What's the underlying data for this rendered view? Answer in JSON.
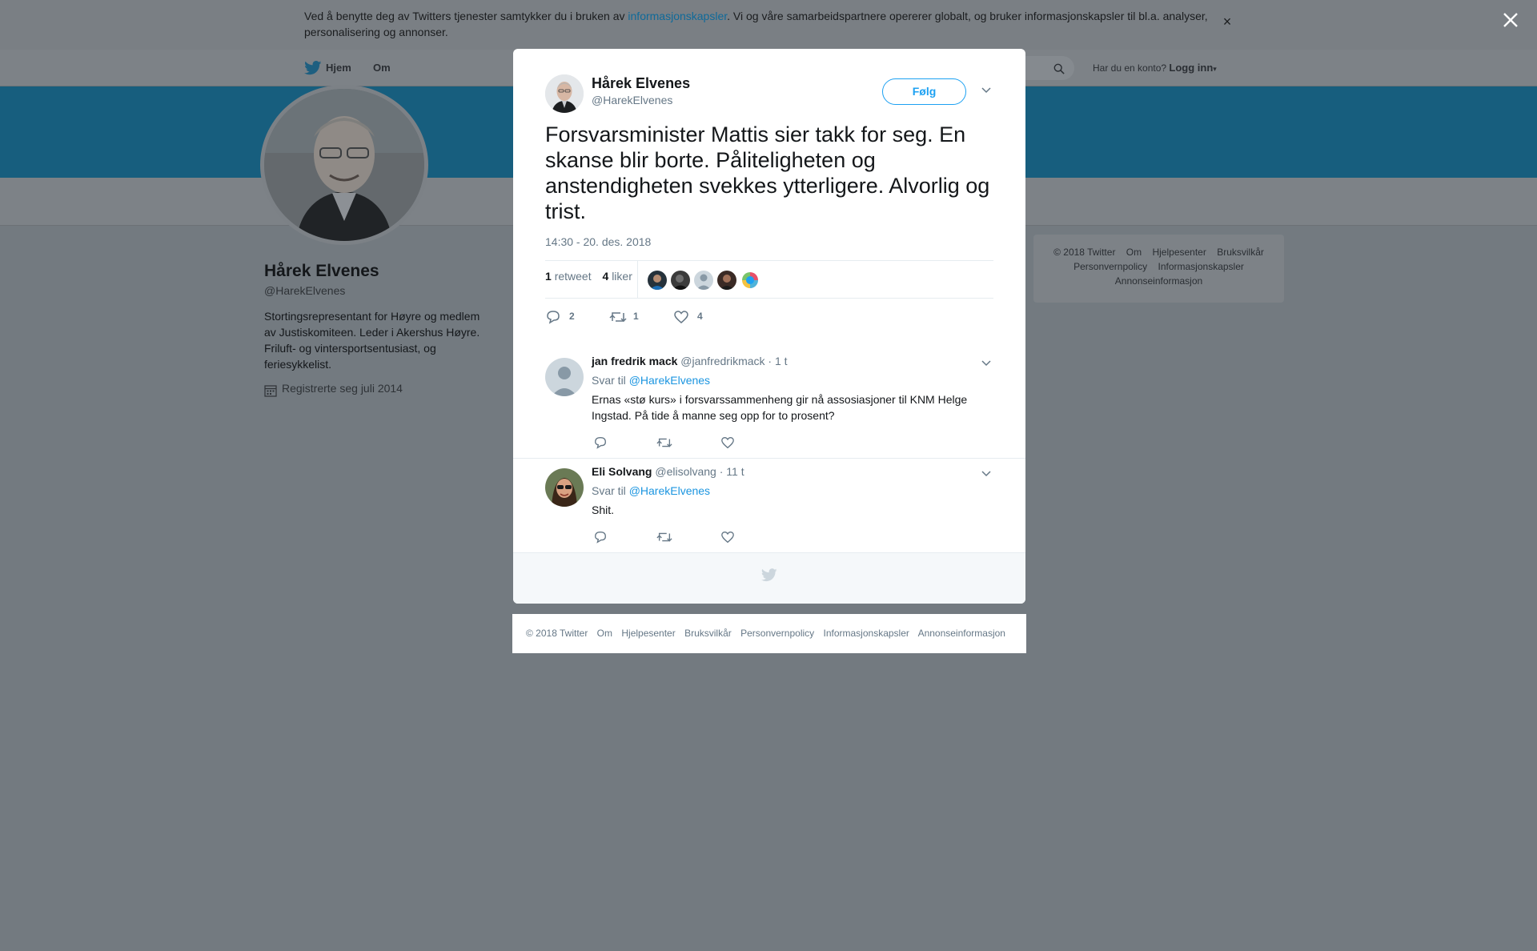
{
  "cookie_bar": {
    "text_before": "Ved å benytte deg av Twitters tjenester samtykker du i bruken av ",
    "link": "informasjonskapsler",
    "text_after": ". Vi og våre samarbeidspartnere opererer globalt, og bruker informasjonskapsler til bl.a. analyser, personalisering og annonser.",
    "close_icon": "×"
  },
  "topnav": {
    "home": "Hjem",
    "about": "Om",
    "login_prompt": "Har du en konto?",
    "login": "Logg inn"
  },
  "profile": {
    "name": "Hårek Elvenes",
    "handle": "@HarekElvenes",
    "bio": "Stortingsrepresentant for Høyre og medlem av Justiskomiteen. Leder i Akershus Høyre. Friluft- og vintersportsentusiast, og feriesykkelist.",
    "joined": "Registrerte seg juli 2014"
  },
  "side_footer": {
    "items": [
      "© 2018 Twitter",
      "Om",
      "Hjelpesenter",
      "Bruksvilkår",
      "Personvernpolicy",
      "Informasjonskapsler",
      "Annonseinformasjon"
    ]
  },
  "tweet": {
    "author_name": "Hårek Elvenes",
    "author_handle": "@HarekElvenes",
    "follow_label": "Følg",
    "text": "Forsvarsminister Mattis sier takk for seg. En skanse blir borte. Påliteligheten og anstendigheten svekkes ytterligere. Alvorlig og trist.",
    "timestamp": "14:30 - 20. des. 2018",
    "retweet_count": "1",
    "retweet_label": "retweet",
    "like_count": "4",
    "like_label": "liker",
    "actions": {
      "replies": "2",
      "retweets": "1",
      "likes": "4"
    }
  },
  "replies": [
    {
      "name": "jan fredrik mack",
      "handle": "@janfredrikmack",
      "time": "· 1 t",
      "reply_to_label": "Svar til",
      "reply_to": "@HarekElvenes",
      "text": "Ernas «stø kurs» i forsvarssammenheng gir nå assosiasjoner til KNM Helge Ingstad. På tide å manne seg opp for to prosent?"
    },
    {
      "name": "Eli Solvang",
      "handle": "@elisolvang",
      "time": "· 11 t",
      "reply_to_label": "Svar til",
      "reply_to": "@HarekElvenes",
      "text": "Shit."
    }
  ],
  "bottom_footer": {
    "items": [
      "© 2018 Twitter",
      "Om",
      "Hjelpesenter",
      "Bruksvilkår",
      "Personvernpolicy",
      "Informasjonskapsler",
      "Annonseinformasjon"
    ]
  },
  "icons": {
    "brand_color": "#1da1f2",
    "list": [
      "twitter-bird-icon",
      "search-icon",
      "calendar-icon",
      "chevron-down-icon",
      "reply-icon",
      "retweet-icon",
      "heart-icon",
      "close-icon"
    ]
  }
}
